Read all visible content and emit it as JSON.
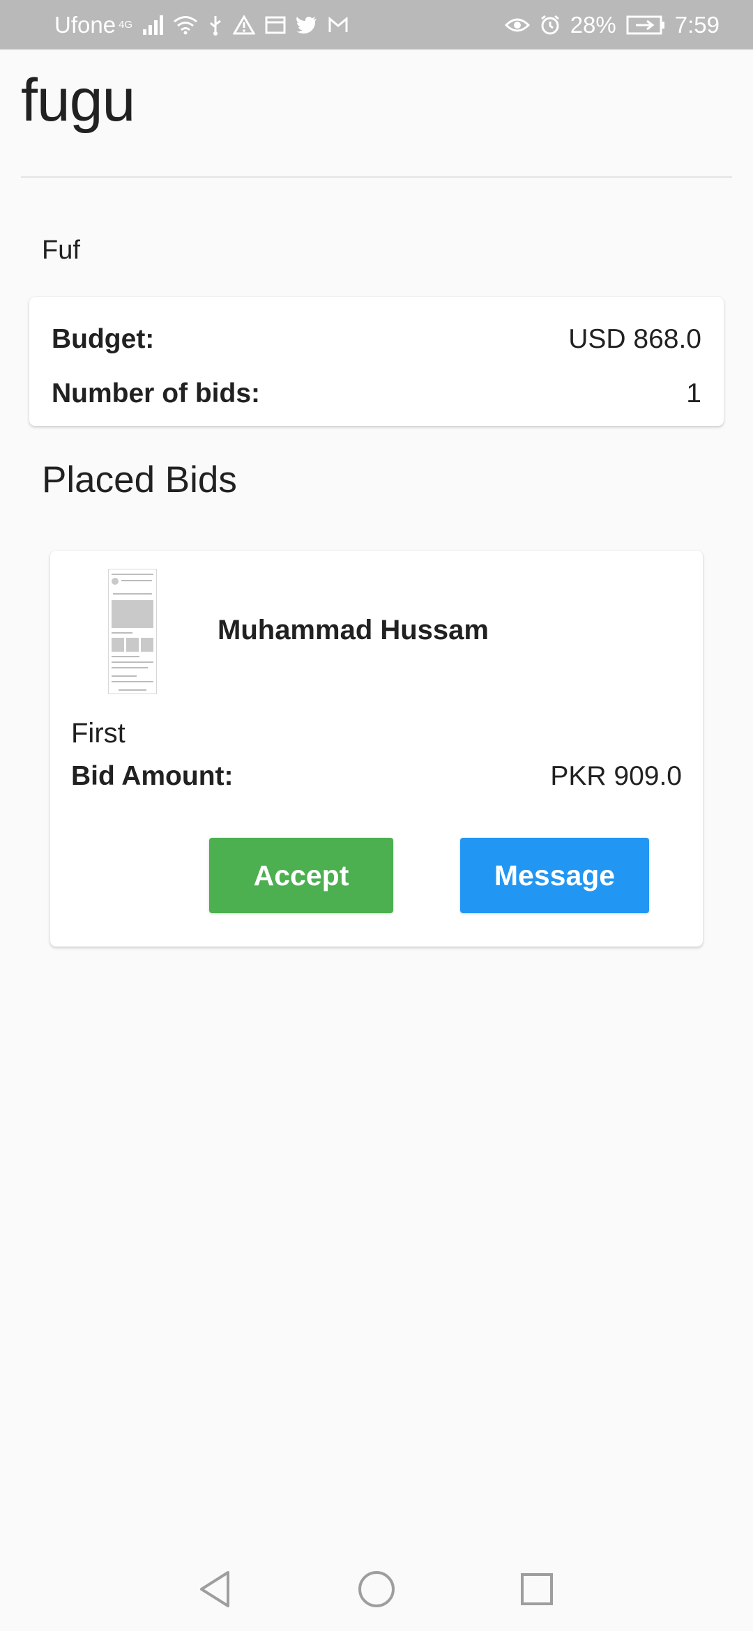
{
  "status_bar": {
    "carrier": "Ufone",
    "network": "4G",
    "battery": "28%",
    "time": "7:59"
  },
  "app": {
    "title": "fugu"
  },
  "job": {
    "description": "Fuf",
    "budget_label": "Budget:",
    "budget_value": "USD 868.0",
    "bids_label": "Number of bids:",
    "bids_value": "1"
  },
  "placed_bids": {
    "title": "Placed Bids",
    "items": [
      {
        "bidder_name": "Muhammad Hussam",
        "note": "First",
        "amount_label": "Bid Amount:",
        "amount_value": "PKR 909.0",
        "accept_label": "Accept",
        "message_label": "Message"
      }
    ]
  },
  "colors": {
    "accept": "#4caf50",
    "message": "#2196f3",
    "status_bar": "#b9b9b9"
  },
  "nav": {
    "icons": [
      "back-icon",
      "home-icon",
      "recents-icon"
    ]
  }
}
